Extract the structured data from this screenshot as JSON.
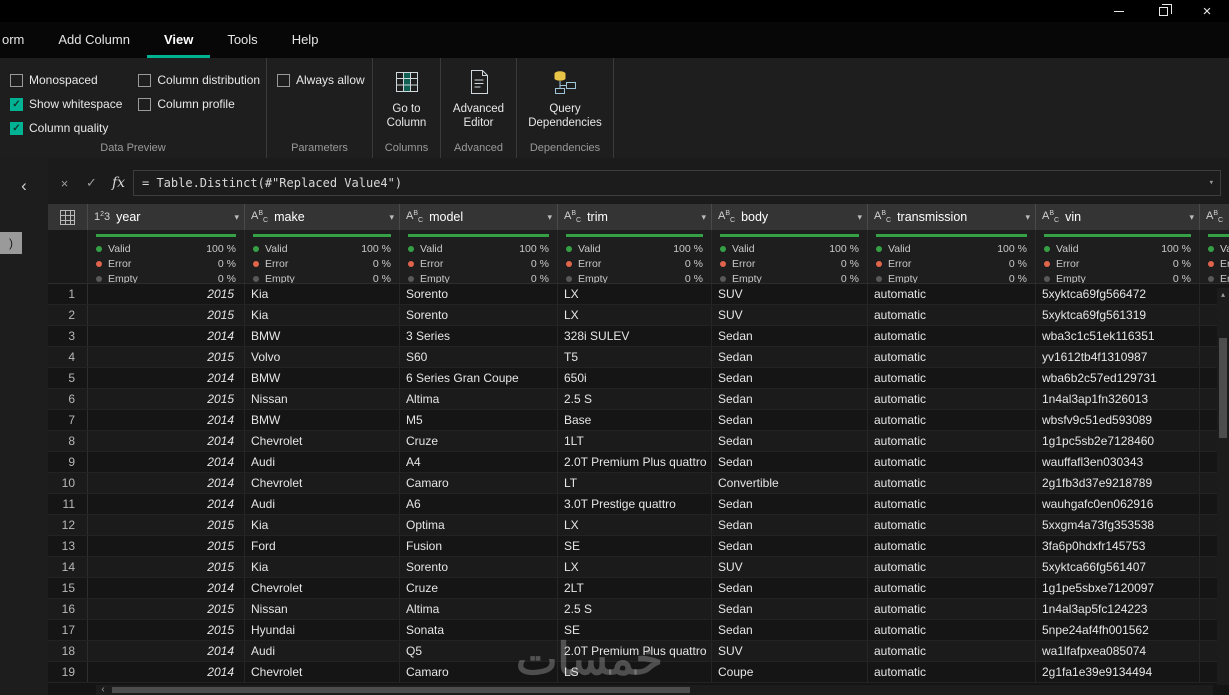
{
  "accent_color": "#00b294",
  "window_controls": [
    "minimize",
    "restore",
    "close"
  ],
  "menu": {
    "tabs": [
      {
        "label": "orm",
        "active": false
      },
      {
        "label": "Add Column",
        "active": false
      },
      {
        "label": "View",
        "active": true
      },
      {
        "label": "Tools",
        "active": false
      },
      {
        "label": "Help",
        "active": false
      }
    ]
  },
  "ribbon": {
    "data_preview": {
      "label": "Data Preview",
      "col1": [
        {
          "label": "Monospaced",
          "checked": false
        },
        {
          "label": "Show whitespace",
          "checked": true
        },
        {
          "label": "Column quality",
          "checked": true
        }
      ],
      "col2": [
        {
          "label": "Column distribution",
          "checked": false
        },
        {
          "label": "Column profile",
          "checked": false
        }
      ]
    },
    "parameters": {
      "label": "Parameters",
      "check": {
        "label": "Always allow",
        "checked": false
      }
    },
    "columns": {
      "label": "Columns",
      "button": "Go to Column"
    },
    "advanced": {
      "label": "Advanced",
      "button": "Advanced Editor"
    },
    "dependencies": {
      "label": "Dependencies",
      "button": "Query Dependencies"
    }
  },
  "formula_bar": {
    "cancel": "×",
    "commit": "✓",
    "fx": "fx",
    "text": "= Table.Distinct(#\"Replaced Value4\")"
  },
  "side_panel": {
    "collapsed_tab": ")"
  },
  "table": {
    "columns": [
      {
        "type": "number",
        "label": "year"
      },
      {
        "type": "text",
        "label": "make"
      },
      {
        "type": "text",
        "label": "model"
      },
      {
        "type": "text",
        "label": "trim"
      },
      {
        "type": "text",
        "label": "body"
      },
      {
        "type": "text",
        "label": "transmission"
      },
      {
        "type": "text",
        "label": "vin"
      },
      {
        "type": "text",
        "label": ""
      }
    ],
    "quality_rows": [
      {
        "label": "Valid",
        "value": "100 %",
        "status": "valid"
      },
      {
        "label": "Error",
        "value": "0 %",
        "status": "error"
      },
      {
        "label": "Empty",
        "value": "0 %",
        "status": "empty"
      }
    ],
    "rows": [
      {
        "n": 1,
        "year": "2015",
        "make": "Kia",
        "model": "Sorento",
        "trim": "LX",
        "body": "SUV",
        "transmission": "automatic",
        "vin": "5xyktca69fg566472"
      },
      {
        "n": 2,
        "year": "2015",
        "make": "Kia",
        "model": "Sorento",
        "trim": "LX",
        "body": "SUV",
        "transmission": "automatic",
        "vin": "5xyktca69fg561319"
      },
      {
        "n": 3,
        "year": "2014",
        "make": "BMW",
        "model": "3 Series",
        "trim": "328i SULEV",
        "body": "Sedan",
        "transmission": "automatic",
        "vin": "wba3c1c51ek116351"
      },
      {
        "n": 4,
        "year": "2015",
        "make": "Volvo",
        "model": "S60",
        "trim": "T5",
        "body": "Sedan",
        "transmission": "automatic",
        "vin": "yv1612tb4f1310987"
      },
      {
        "n": 5,
        "year": "2014",
        "make": "BMW",
        "model": "6 Series Gran Coupe",
        "trim": "650i",
        "body": "Sedan",
        "transmission": "automatic",
        "vin": "wba6b2c57ed129731"
      },
      {
        "n": 6,
        "year": "2015",
        "make": "Nissan",
        "model": "Altima",
        "trim": "2.5 S",
        "body": "Sedan",
        "transmission": "automatic",
        "vin": "1n4al3ap1fn326013"
      },
      {
        "n": 7,
        "year": "2014",
        "make": "BMW",
        "model": "M5",
        "trim": "Base",
        "body": "Sedan",
        "transmission": "automatic",
        "vin": "wbsfv9c51ed593089"
      },
      {
        "n": 8,
        "year": "2014",
        "make": "Chevrolet",
        "model": "Cruze",
        "trim": "1LT",
        "body": "Sedan",
        "transmission": "automatic",
        "vin": "1g1pc5sb2e7128460"
      },
      {
        "n": 9,
        "year": "2014",
        "make": "Audi",
        "model": "A4",
        "trim": "2.0T Premium Plus quattro",
        "body": "Sedan",
        "transmission": "automatic",
        "vin": "wauffafl3en030343"
      },
      {
        "n": 10,
        "year": "2014",
        "make": "Chevrolet",
        "model": "Camaro",
        "trim": "LT",
        "body": "Convertible",
        "transmission": "automatic",
        "vin": "2g1fb3d37e9218789"
      },
      {
        "n": 11,
        "year": "2014",
        "make": "Audi",
        "model": "A6",
        "trim": "3.0T Prestige quattro",
        "body": "Sedan",
        "transmission": "automatic",
        "vin": "wauhgafc0en062916"
      },
      {
        "n": 12,
        "year": "2015",
        "make": "Kia",
        "model": "Optima",
        "trim": "LX",
        "body": "Sedan",
        "transmission": "automatic",
        "vin": "5xxgm4a73fg353538"
      },
      {
        "n": 13,
        "year": "2015",
        "make": "Ford",
        "model": "Fusion",
        "trim": "SE",
        "body": "Sedan",
        "transmission": "automatic",
        "vin": "3fa6p0hdxfr145753"
      },
      {
        "n": 14,
        "year": "2015",
        "make": "Kia",
        "model": "Sorento",
        "trim": "LX",
        "body": "SUV",
        "transmission": "automatic",
        "vin": "5xyktca66fg561407"
      },
      {
        "n": 15,
        "year": "2014",
        "make": "Chevrolet",
        "model": "Cruze",
        "trim": "2LT",
        "body": "Sedan",
        "transmission": "automatic",
        "vin": "1g1pe5sbxe7120097"
      },
      {
        "n": 16,
        "year": "2015",
        "make": "Nissan",
        "model": "Altima",
        "trim": "2.5 S",
        "body": "Sedan",
        "transmission": "automatic",
        "vin": "1n4al3ap5fc124223"
      },
      {
        "n": 17,
        "year": "2015",
        "make": "Hyundai",
        "model": "Sonata",
        "trim": "SE",
        "body": "Sedan",
        "transmission": "automatic",
        "vin": "5npe24af4fh001562"
      },
      {
        "n": 18,
        "year": "2014",
        "make": "Audi",
        "model": "Q5",
        "trim": "2.0T Premium Plus quattro",
        "body": "SUV",
        "transmission": "automatic",
        "vin": "wa1lfafpxea085074"
      },
      {
        "n": 19,
        "year": "2014",
        "make": "Chevrolet",
        "model": "Camaro",
        "trim": "LS",
        "body": "Coupe",
        "transmission": "automatic",
        "vin": "2g1fa1e39e9134494"
      }
    ]
  },
  "watermark": "خمسات"
}
